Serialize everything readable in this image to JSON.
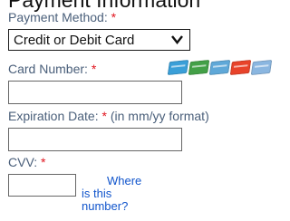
{
  "section": {
    "title": "Payment Information"
  },
  "payment_method": {
    "label": "Payment Method:",
    "required_mark": "*",
    "selected": "Credit or Debit Card"
  },
  "card_number": {
    "label": "Card Number:",
    "required_mark": "*",
    "value": "",
    "card_icons": [
      {
        "name": "amex-card-icon",
        "color": "#3a9fd8"
      },
      {
        "name": "mastercard-card-icon",
        "color": "#43a047"
      },
      {
        "name": "visa-card-icon",
        "color": "#5fa8d8"
      },
      {
        "name": "discover-card-icon",
        "color": "#e8432a"
      },
      {
        "name": "diners-card-icon",
        "color": "#8ab6e0"
      }
    ]
  },
  "expiration": {
    "label": "Expiration Date:",
    "required_mark": "*",
    "hint": "(in mm/yy format)",
    "value": ""
  },
  "cvv": {
    "label": "CVV:",
    "required_mark": "*",
    "value": "",
    "help_line1": "Where",
    "help_line2": "is this",
    "help_line3": "number?"
  },
  "colors": {
    "label": "#4a5f7a",
    "required": "#e0141e",
    "link": "#1155cc"
  }
}
